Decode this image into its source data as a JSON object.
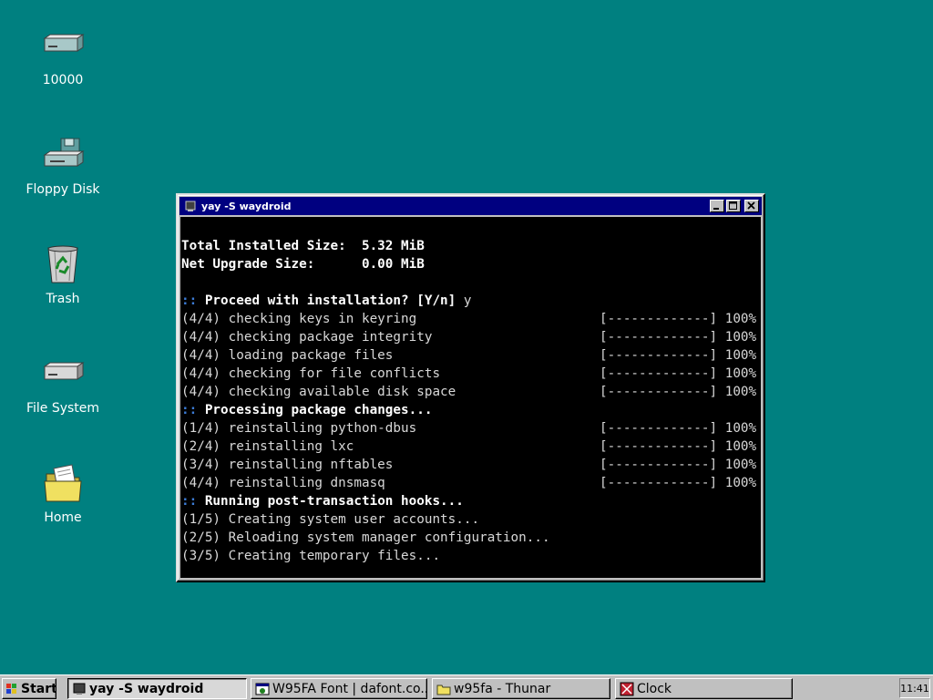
{
  "desktop": {
    "icons": [
      {
        "label": "10000",
        "icon": "hard-drive-icon"
      },
      {
        "label": "Floppy Disk",
        "icon": "floppy-drive-icon"
      },
      {
        "label": "Trash",
        "icon": "recycle-bin-icon"
      },
      {
        "label": "File System",
        "icon": "hard-drive-icon"
      },
      {
        "label": "Home",
        "icon": "folder-icon"
      }
    ],
    "background_color": "#008080"
  },
  "window": {
    "title": "yay -S waydroid",
    "terminal": {
      "blank_line": "",
      "total_installed_size": "Total Installed Size:  5.32 MiB",
      "net_upgrade_size": "Net Upgrade Size:      0.00 MiB",
      "proceed_prefix": "::",
      "proceed_text": " Proceed with installation? [Y/n]",
      "proceed_answer": " y",
      "checks": [
        {
          "text": "(4/4) checking keys in keyring",
          "bar": "[-------------] 100%"
        },
        {
          "text": "(4/4) checking package integrity",
          "bar": "[-------------] 100%"
        },
        {
          "text": "(4/4) loading package files",
          "bar": "[-------------] 100%"
        },
        {
          "text": "(4/4) checking for file conflicts",
          "bar": "[-------------] 100%"
        },
        {
          "text": "(4/4) checking available disk space",
          "bar": "[-------------] 100%"
        }
      ],
      "processing_prefix": "::",
      "processing_text": " Processing package changes...",
      "reinstalls": [
        {
          "text": "(1/4) reinstalling python-dbus",
          "bar": "[-------------] 100%"
        },
        {
          "text": "(2/4) reinstalling lxc",
          "bar": "[-------------] 100%"
        },
        {
          "text": "(3/4) reinstalling nftables",
          "bar": "[-------------] 100%"
        },
        {
          "text": "(4/4) reinstalling dnsmasq",
          "bar": "[-------------] 100%"
        }
      ],
      "hooks_prefix": "::",
      "hooks_text": " Running post-transaction hooks...",
      "hooks": [
        "(1/5) Creating system user accounts...",
        "(2/5) Reloading system manager configuration...",
        "(3/5) Creating temporary files..."
      ]
    }
  },
  "taskbar": {
    "start_label": "Start",
    "tasks": [
      {
        "label": "yay -S waydroid",
        "icon": "terminal-icon",
        "active": true
      },
      {
        "label": "W95FA Font | dafont.co...",
        "icon": "browser-icon",
        "active": false
      },
      {
        "label": "w95fa - Thunar",
        "icon": "folder-icon",
        "active": false
      },
      {
        "label": "Clock",
        "icon": "clock-icon",
        "active": false
      }
    ],
    "clock": "11:41"
  },
  "colors": {
    "desktop": "#008080",
    "titlebar": "#000080",
    "terminal_bg": "#000000",
    "prompt_accent": "#3c7cd6"
  }
}
